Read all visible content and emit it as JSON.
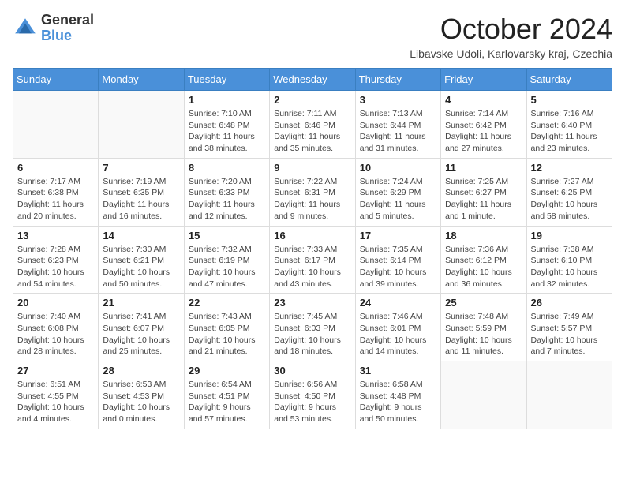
{
  "header": {
    "logo_general": "General",
    "logo_blue": "Blue",
    "month_title": "October 2024",
    "location": "Libavske Udoli, Karlovarsky kraj, Czechia"
  },
  "weekdays": [
    "Sunday",
    "Monday",
    "Tuesday",
    "Wednesday",
    "Thursday",
    "Friday",
    "Saturday"
  ],
  "weeks": [
    [
      {
        "day": "",
        "info": ""
      },
      {
        "day": "",
        "info": ""
      },
      {
        "day": "1",
        "info": "Sunrise: 7:10 AM\nSunset: 6:48 PM\nDaylight: 11 hours and 38 minutes."
      },
      {
        "day": "2",
        "info": "Sunrise: 7:11 AM\nSunset: 6:46 PM\nDaylight: 11 hours and 35 minutes."
      },
      {
        "day": "3",
        "info": "Sunrise: 7:13 AM\nSunset: 6:44 PM\nDaylight: 11 hours and 31 minutes."
      },
      {
        "day": "4",
        "info": "Sunrise: 7:14 AM\nSunset: 6:42 PM\nDaylight: 11 hours and 27 minutes."
      },
      {
        "day": "5",
        "info": "Sunrise: 7:16 AM\nSunset: 6:40 PM\nDaylight: 11 hours and 23 minutes."
      }
    ],
    [
      {
        "day": "6",
        "info": "Sunrise: 7:17 AM\nSunset: 6:38 PM\nDaylight: 11 hours and 20 minutes."
      },
      {
        "day": "7",
        "info": "Sunrise: 7:19 AM\nSunset: 6:35 PM\nDaylight: 11 hours and 16 minutes."
      },
      {
        "day": "8",
        "info": "Sunrise: 7:20 AM\nSunset: 6:33 PM\nDaylight: 11 hours and 12 minutes."
      },
      {
        "day": "9",
        "info": "Sunrise: 7:22 AM\nSunset: 6:31 PM\nDaylight: 11 hours and 9 minutes."
      },
      {
        "day": "10",
        "info": "Sunrise: 7:24 AM\nSunset: 6:29 PM\nDaylight: 11 hours and 5 minutes."
      },
      {
        "day": "11",
        "info": "Sunrise: 7:25 AM\nSunset: 6:27 PM\nDaylight: 11 hours and 1 minute."
      },
      {
        "day": "12",
        "info": "Sunrise: 7:27 AM\nSunset: 6:25 PM\nDaylight: 10 hours and 58 minutes."
      }
    ],
    [
      {
        "day": "13",
        "info": "Sunrise: 7:28 AM\nSunset: 6:23 PM\nDaylight: 10 hours and 54 minutes."
      },
      {
        "day": "14",
        "info": "Sunrise: 7:30 AM\nSunset: 6:21 PM\nDaylight: 10 hours and 50 minutes."
      },
      {
        "day": "15",
        "info": "Sunrise: 7:32 AM\nSunset: 6:19 PM\nDaylight: 10 hours and 47 minutes."
      },
      {
        "day": "16",
        "info": "Sunrise: 7:33 AM\nSunset: 6:17 PM\nDaylight: 10 hours and 43 minutes."
      },
      {
        "day": "17",
        "info": "Sunrise: 7:35 AM\nSunset: 6:14 PM\nDaylight: 10 hours and 39 minutes."
      },
      {
        "day": "18",
        "info": "Sunrise: 7:36 AM\nSunset: 6:12 PM\nDaylight: 10 hours and 36 minutes."
      },
      {
        "day": "19",
        "info": "Sunrise: 7:38 AM\nSunset: 6:10 PM\nDaylight: 10 hours and 32 minutes."
      }
    ],
    [
      {
        "day": "20",
        "info": "Sunrise: 7:40 AM\nSunset: 6:08 PM\nDaylight: 10 hours and 28 minutes."
      },
      {
        "day": "21",
        "info": "Sunrise: 7:41 AM\nSunset: 6:07 PM\nDaylight: 10 hours and 25 minutes."
      },
      {
        "day": "22",
        "info": "Sunrise: 7:43 AM\nSunset: 6:05 PM\nDaylight: 10 hours and 21 minutes."
      },
      {
        "day": "23",
        "info": "Sunrise: 7:45 AM\nSunset: 6:03 PM\nDaylight: 10 hours and 18 minutes."
      },
      {
        "day": "24",
        "info": "Sunrise: 7:46 AM\nSunset: 6:01 PM\nDaylight: 10 hours and 14 minutes."
      },
      {
        "day": "25",
        "info": "Sunrise: 7:48 AM\nSunset: 5:59 PM\nDaylight: 10 hours and 11 minutes."
      },
      {
        "day": "26",
        "info": "Sunrise: 7:49 AM\nSunset: 5:57 PM\nDaylight: 10 hours and 7 minutes."
      }
    ],
    [
      {
        "day": "27",
        "info": "Sunrise: 6:51 AM\nSunset: 4:55 PM\nDaylight: 10 hours and 4 minutes."
      },
      {
        "day": "28",
        "info": "Sunrise: 6:53 AM\nSunset: 4:53 PM\nDaylight: 10 hours and 0 minutes."
      },
      {
        "day": "29",
        "info": "Sunrise: 6:54 AM\nSunset: 4:51 PM\nDaylight: 9 hours and 57 minutes."
      },
      {
        "day": "30",
        "info": "Sunrise: 6:56 AM\nSunset: 4:50 PM\nDaylight: 9 hours and 53 minutes."
      },
      {
        "day": "31",
        "info": "Sunrise: 6:58 AM\nSunset: 4:48 PM\nDaylight: 9 hours and 50 minutes."
      },
      {
        "day": "",
        "info": ""
      },
      {
        "day": "",
        "info": ""
      }
    ]
  ]
}
